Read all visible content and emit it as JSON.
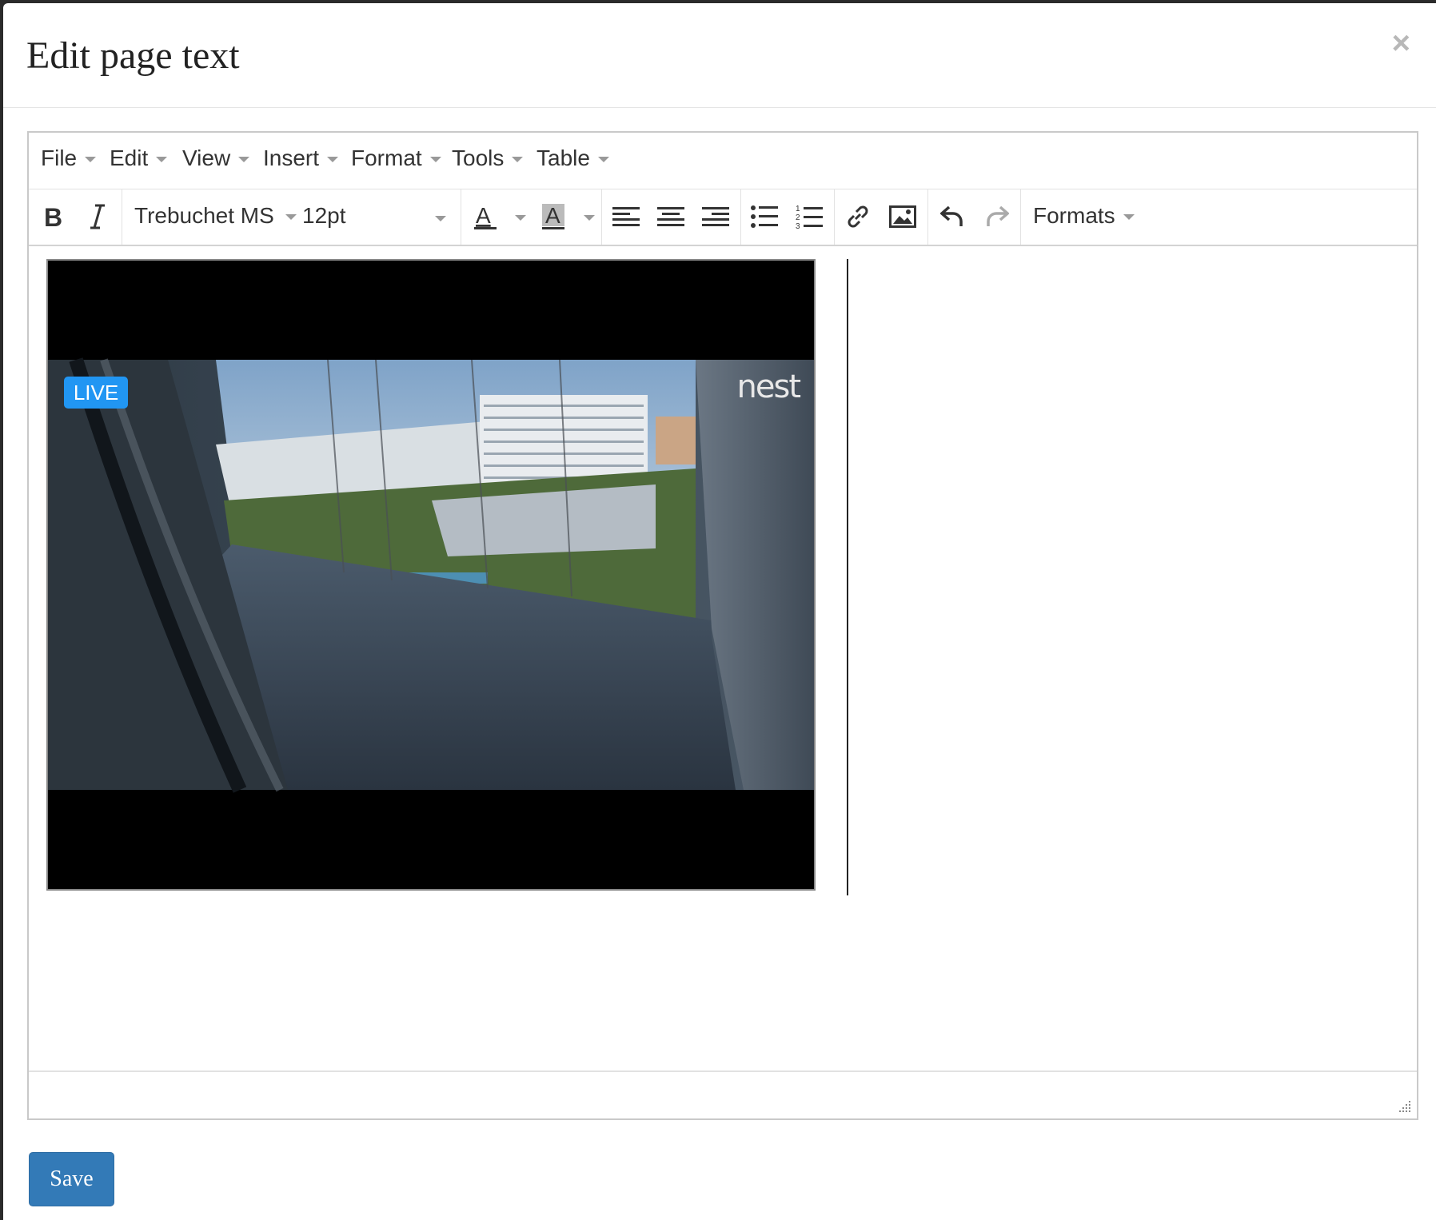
{
  "dialog": {
    "title": "Edit page text",
    "close_icon": "close-icon"
  },
  "menubar": {
    "items": [
      {
        "label": "File"
      },
      {
        "label": "Edit"
      },
      {
        "label": "View"
      },
      {
        "label": "Insert"
      },
      {
        "label": "Format"
      },
      {
        "label": "Tools"
      },
      {
        "label": "Table"
      }
    ]
  },
  "toolbar": {
    "font_family": "Trebuchet MS",
    "font_size": "12pt",
    "formats_label": "Formats",
    "icons": [
      "bold-icon",
      "italic-icon",
      "text-color-icon",
      "background-color-icon",
      "align-left-icon",
      "align-center-icon",
      "align-right-icon",
      "bullet-list-icon",
      "numbered-list-icon",
      "link-icon",
      "image-icon",
      "undo-icon",
      "redo-icon"
    ]
  },
  "content": {
    "video": {
      "badge": "LIVE",
      "watermark": "nest"
    }
  },
  "footer": {
    "save_label": "Save"
  },
  "colors": {
    "primary": "#337ab7",
    "live_badge": "#2196f3"
  }
}
